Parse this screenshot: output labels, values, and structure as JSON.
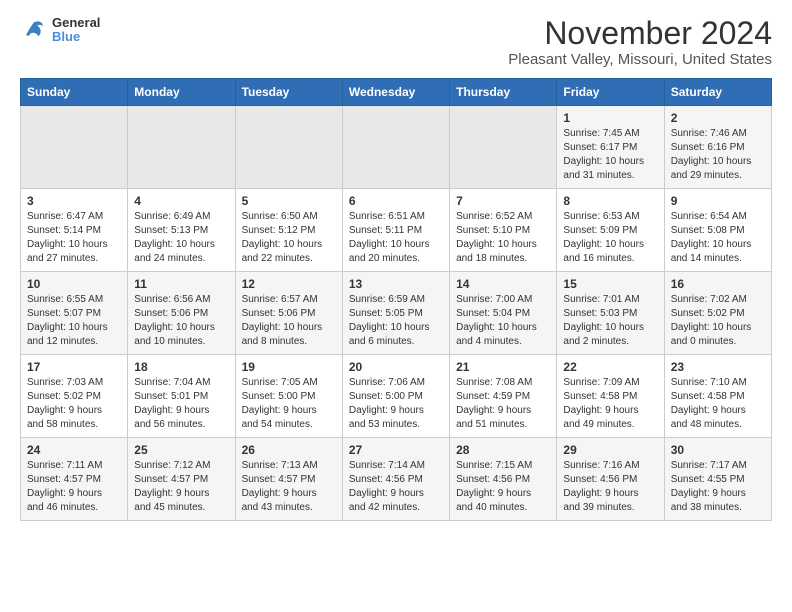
{
  "logo": {
    "line1": "General",
    "line2": "Blue"
  },
  "title": "November 2024",
  "subtitle": "Pleasant Valley, Missouri, United States",
  "weekdays": [
    "Sunday",
    "Monday",
    "Tuesday",
    "Wednesday",
    "Thursday",
    "Friday",
    "Saturday"
  ],
  "weeks": [
    [
      {
        "day": "",
        "info": ""
      },
      {
        "day": "",
        "info": ""
      },
      {
        "day": "",
        "info": ""
      },
      {
        "day": "",
        "info": ""
      },
      {
        "day": "",
        "info": ""
      },
      {
        "day": "1",
        "info": "Sunrise: 7:45 AM\nSunset: 6:17 PM\nDaylight: 10 hours\nand 31 minutes."
      },
      {
        "day": "2",
        "info": "Sunrise: 7:46 AM\nSunset: 6:16 PM\nDaylight: 10 hours\nand 29 minutes."
      }
    ],
    [
      {
        "day": "3",
        "info": "Sunrise: 6:47 AM\nSunset: 5:14 PM\nDaylight: 10 hours\nand 27 minutes."
      },
      {
        "day": "4",
        "info": "Sunrise: 6:49 AM\nSunset: 5:13 PM\nDaylight: 10 hours\nand 24 minutes."
      },
      {
        "day": "5",
        "info": "Sunrise: 6:50 AM\nSunset: 5:12 PM\nDaylight: 10 hours\nand 22 minutes."
      },
      {
        "day": "6",
        "info": "Sunrise: 6:51 AM\nSunset: 5:11 PM\nDaylight: 10 hours\nand 20 minutes."
      },
      {
        "day": "7",
        "info": "Sunrise: 6:52 AM\nSunset: 5:10 PM\nDaylight: 10 hours\nand 18 minutes."
      },
      {
        "day": "8",
        "info": "Sunrise: 6:53 AM\nSunset: 5:09 PM\nDaylight: 10 hours\nand 16 minutes."
      },
      {
        "day": "9",
        "info": "Sunrise: 6:54 AM\nSunset: 5:08 PM\nDaylight: 10 hours\nand 14 minutes."
      }
    ],
    [
      {
        "day": "10",
        "info": "Sunrise: 6:55 AM\nSunset: 5:07 PM\nDaylight: 10 hours\nand 12 minutes."
      },
      {
        "day": "11",
        "info": "Sunrise: 6:56 AM\nSunset: 5:06 PM\nDaylight: 10 hours\nand 10 minutes."
      },
      {
        "day": "12",
        "info": "Sunrise: 6:57 AM\nSunset: 5:06 PM\nDaylight: 10 hours\nand 8 minutes."
      },
      {
        "day": "13",
        "info": "Sunrise: 6:59 AM\nSunset: 5:05 PM\nDaylight: 10 hours\nand 6 minutes."
      },
      {
        "day": "14",
        "info": "Sunrise: 7:00 AM\nSunset: 5:04 PM\nDaylight: 10 hours\nand 4 minutes."
      },
      {
        "day": "15",
        "info": "Sunrise: 7:01 AM\nSunset: 5:03 PM\nDaylight: 10 hours\nand 2 minutes."
      },
      {
        "day": "16",
        "info": "Sunrise: 7:02 AM\nSunset: 5:02 PM\nDaylight: 10 hours\nand 0 minutes."
      }
    ],
    [
      {
        "day": "17",
        "info": "Sunrise: 7:03 AM\nSunset: 5:02 PM\nDaylight: 9 hours\nand 58 minutes."
      },
      {
        "day": "18",
        "info": "Sunrise: 7:04 AM\nSunset: 5:01 PM\nDaylight: 9 hours\nand 56 minutes."
      },
      {
        "day": "19",
        "info": "Sunrise: 7:05 AM\nSunset: 5:00 PM\nDaylight: 9 hours\nand 54 minutes."
      },
      {
        "day": "20",
        "info": "Sunrise: 7:06 AM\nSunset: 5:00 PM\nDaylight: 9 hours\nand 53 minutes."
      },
      {
        "day": "21",
        "info": "Sunrise: 7:08 AM\nSunset: 4:59 PM\nDaylight: 9 hours\nand 51 minutes."
      },
      {
        "day": "22",
        "info": "Sunrise: 7:09 AM\nSunset: 4:58 PM\nDaylight: 9 hours\nand 49 minutes."
      },
      {
        "day": "23",
        "info": "Sunrise: 7:10 AM\nSunset: 4:58 PM\nDaylight: 9 hours\nand 48 minutes."
      }
    ],
    [
      {
        "day": "24",
        "info": "Sunrise: 7:11 AM\nSunset: 4:57 PM\nDaylight: 9 hours\nand 46 minutes."
      },
      {
        "day": "25",
        "info": "Sunrise: 7:12 AM\nSunset: 4:57 PM\nDaylight: 9 hours\nand 45 minutes."
      },
      {
        "day": "26",
        "info": "Sunrise: 7:13 AM\nSunset: 4:57 PM\nDaylight: 9 hours\nand 43 minutes."
      },
      {
        "day": "27",
        "info": "Sunrise: 7:14 AM\nSunset: 4:56 PM\nDaylight: 9 hours\nand 42 minutes."
      },
      {
        "day": "28",
        "info": "Sunrise: 7:15 AM\nSunset: 4:56 PM\nDaylight: 9 hours\nand 40 minutes."
      },
      {
        "day": "29",
        "info": "Sunrise: 7:16 AM\nSunset: 4:56 PM\nDaylight: 9 hours\nand 39 minutes."
      },
      {
        "day": "30",
        "info": "Sunrise: 7:17 AM\nSunset: 4:55 PM\nDaylight: 9 hours\nand 38 minutes."
      }
    ]
  ]
}
